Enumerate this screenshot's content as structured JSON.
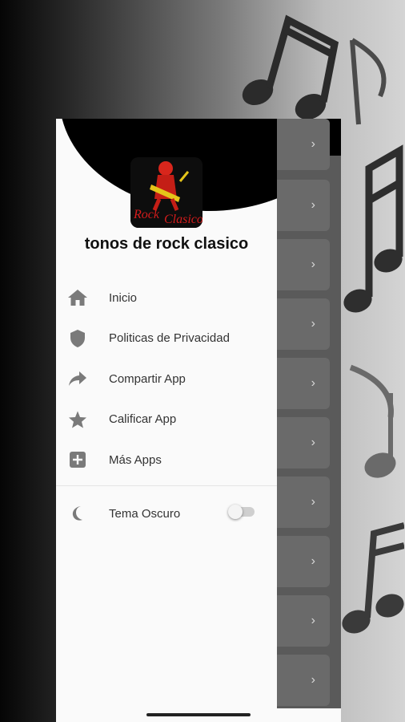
{
  "app": {
    "name": "tonos de rock clasico",
    "logo_text": "RockClasico"
  },
  "menu": {
    "items": [
      {
        "label": "Inicio",
        "icon": "home-icon"
      },
      {
        "label": "Politicas de Privacidad",
        "icon": "shield-icon"
      },
      {
        "label": "Compartir App",
        "icon": "share-icon"
      },
      {
        "label": "Calificar App",
        "icon": "star-icon"
      },
      {
        "label": "Más Apps",
        "icon": "add-box-icon"
      }
    ]
  },
  "theme": {
    "label": "Tema Oscuro",
    "icon": "moon-icon",
    "dark_mode_enabled": false
  },
  "list": {
    "chevron": "›",
    "item_count": 10
  },
  "colors": {
    "drawer_background": "#fafafa",
    "header_background": "#000000",
    "icon_gray": "#7a7a7a",
    "list_item": "#6a6a6a"
  }
}
